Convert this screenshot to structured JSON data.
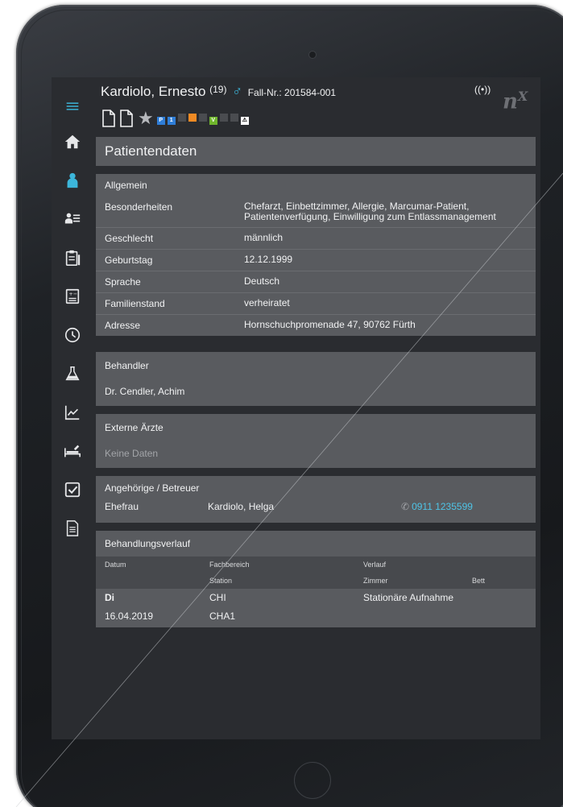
{
  "patient": {
    "name": "Kardiolo, Ernesto",
    "age": "(19)",
    "sex_symbol": "♂",
    "case_number": "Fall-Nr.: 201584-001"
  },
  "header": {
    "signal_icon": "((•))",
    "logo": "n",
    "logo_sup": "X",
    "star": "★",
    "flags": [
      {
        "label": "P",
        "color": "#2f7ed8"
      },
      {
        "label": "1",
        "color": "#2f7ed8"
      },
      {
        "label": "",
        "color": "#4a4c50"
      },
      {
        "label": "",
        "color": "#f08a24"
      },
      {
        "label": "",
        "color": "#4a4c50"
      },
      {
        "label": "V",
        "color": "#6fb52c"
      },
      {
        "label": "",
        "color": "#4a4c50"
      },
      {
        "label": "",
        "color": "#4a4c50"
      },
      {
        "label": "⚠",
        "color": "#222222"
      }
    ]
  },
  "page_title": "Patientendaten",
  "allgemein": {
    "title": "Allgemein",
    "rows": [
      {
        "label": "Besonderheiten",
        "value": "Chefarzt, Einbettzimmer, Allergie, Marcumar-Patient, Patientenverfügung, Einwilligung zum Entlassmanagement"
      },
      {
        "label": "Geschlecht",
        "value": "männlich"
      },
      {
        "label": "Geburtstag",
        "value": "12.12.1999"
      },
      {
        "label": "Sprache",
        "value": "Deutsch"
      },
      {
        "label": "Familienstand",
        "value": "verheiratet"
      },
      {
        "label": "Adresse",
        "value": "Hornschuchpromenade 47, 90762 Fürth"
      }
    ]
  },
  "behandler": {
    "title": "Behandler",
    "name": "Dr. Cendler, Achim"
  },
  "externe_aerzte": {
    "title": "Externe Ärzte",
    "empty": "Keine Daten"
  },
  "angehoerige": {
    "title": "Angehörige / Betreuer",
    "relation": "Ehefrau",
    "name": "Kardiolo, Helga",
    "phone_icon": "✆",
    "phone": "0911 1235599"
  },
  "behandlungsverlauf": {
    "title": "Behandlungsverlauf",
    "head1": {
      "c1": "Datum",
      "c2": "Fachbereich",
      "c3": "Verlauf",
      "c4": ""
    },
    "head2": {
      "c1": "",
      "c2": "Station",
      "c3": "Zimmer",
      "c4": "Bett"
    },
    "row1": {
      "c1": "Di",
      "c2": "CHI",
      "c3": "Stationäre Aufnahme",
      "c4": ""
    },
    "row2": {
      "c1": "16.04.2019",
      "c2": "CHA1",
      "c3": "",
      "c4": ""
    }
  },
  "sidebar": {
    "items": [
      "menu-icon",
      "home-icon",
      "patient-icon",
      "patient-list-icon",
      "clipboard-icon",
      "vitals-sheet-icon",
      "clock-icon",
      "lab-flask-icon",
      "chart-trend-icon",
      "bed-icon",
      "checklist-icon",
      "document-icon"
    ],
    "accent": "#3cb6da"
  }
}
